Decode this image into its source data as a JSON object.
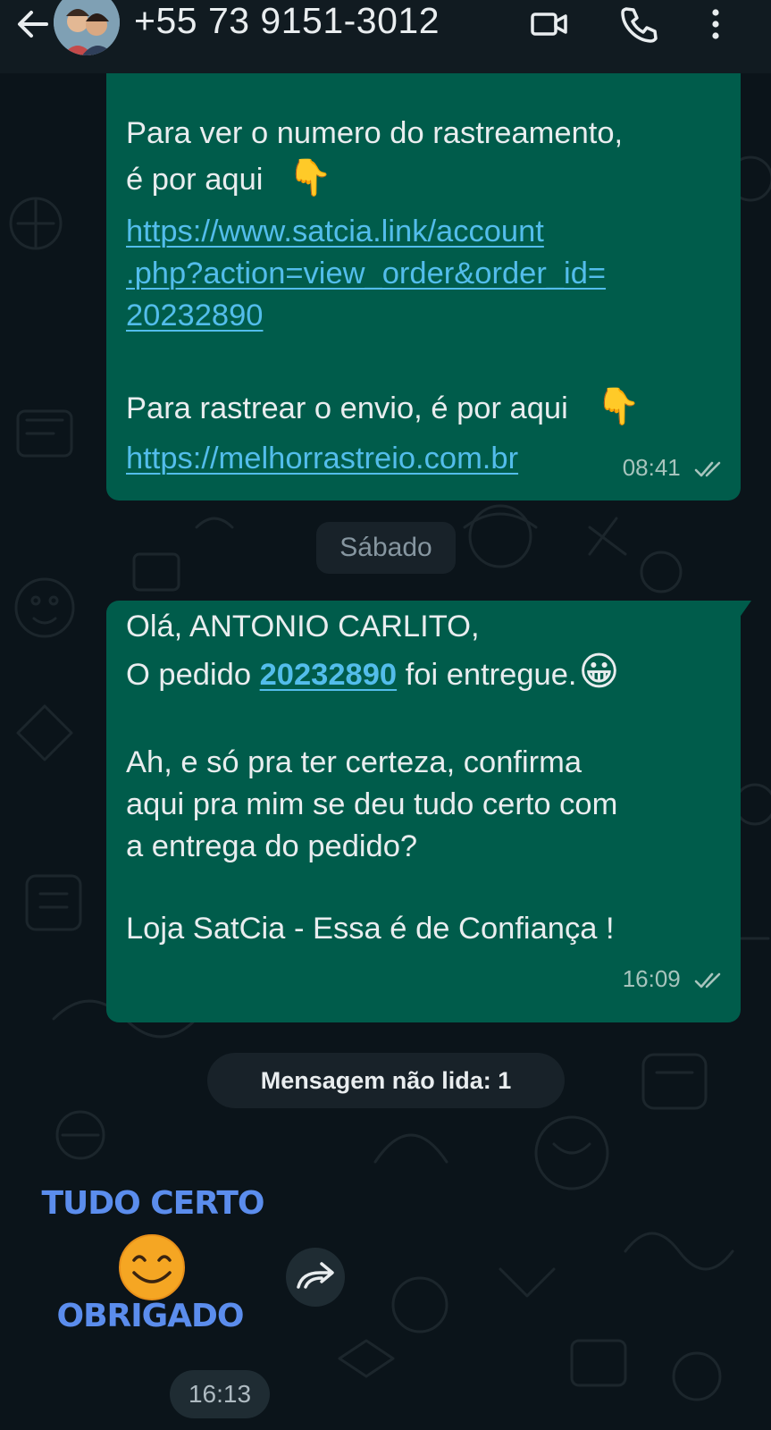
{
  "header": {
    "contact_name": "+55 73 9151-3012",
    "icons": [
      "back-arrow-icon",
      "video-call-icon",
      "voice-call-icon",
      "more-options-icon"
    ]
  },
  "messages": [
    {
      "id": "msg1",
      "lines": {
        "l1": "Para ver o numero do rastreamento,",
        "l2": "é por aqui",
        "l2_emoji": "👇",
        "url1_a": "https://www.satcia.link/account",
        "url1_b": ".php?action=view_order&order_id=",
        "url1_c": "20232890",
        "l6": "Para rastrear o envio, é por aqui",
        "l6_emoji": "👇",
        "url2": "https://melhorrastreio.com.br"
      },
      "time": "08:41",
      "status": "read"
    },
    {
      "id": "msg2",
      "lines": {
        "l1": "Olá, ANTONIO CARLITO,",
        "l2_pre": "O pedido ",
        "l2_order": "20232890",
        "l2_post": " foi entregue.",
        "l2_emoji": "😀",
        "l3": "Ah, e só pra ter certeza, confirma",
        "l4": "aqui pra mim se deu tudo certo com",
        "l5": "a entrega do pedido?",
        "l6": "Loja SatCia - Essa é de Confiança !"
      },
      "time": "16:09",
      "status": "read"
    }
  ],
  "date_divider": "Sábado",
  "unread_divider": "Mensagem não lida: 1",
  "sticker": {
    "line1": "TUDO CERTO",
    "line2": "OBRIGADO",
    "emoji": "smiling-face-icon",
    "time": "16:13"
  },
  "colors": {
    "background": "#0b141a",
    "header": "#111b21",
    "outgoing_bubble": "#005c4b",
    "link": "#53bdeb",
    "sticker_text": "#5b8ded",
    "ticks": "#a7c4bd"
  }
}
